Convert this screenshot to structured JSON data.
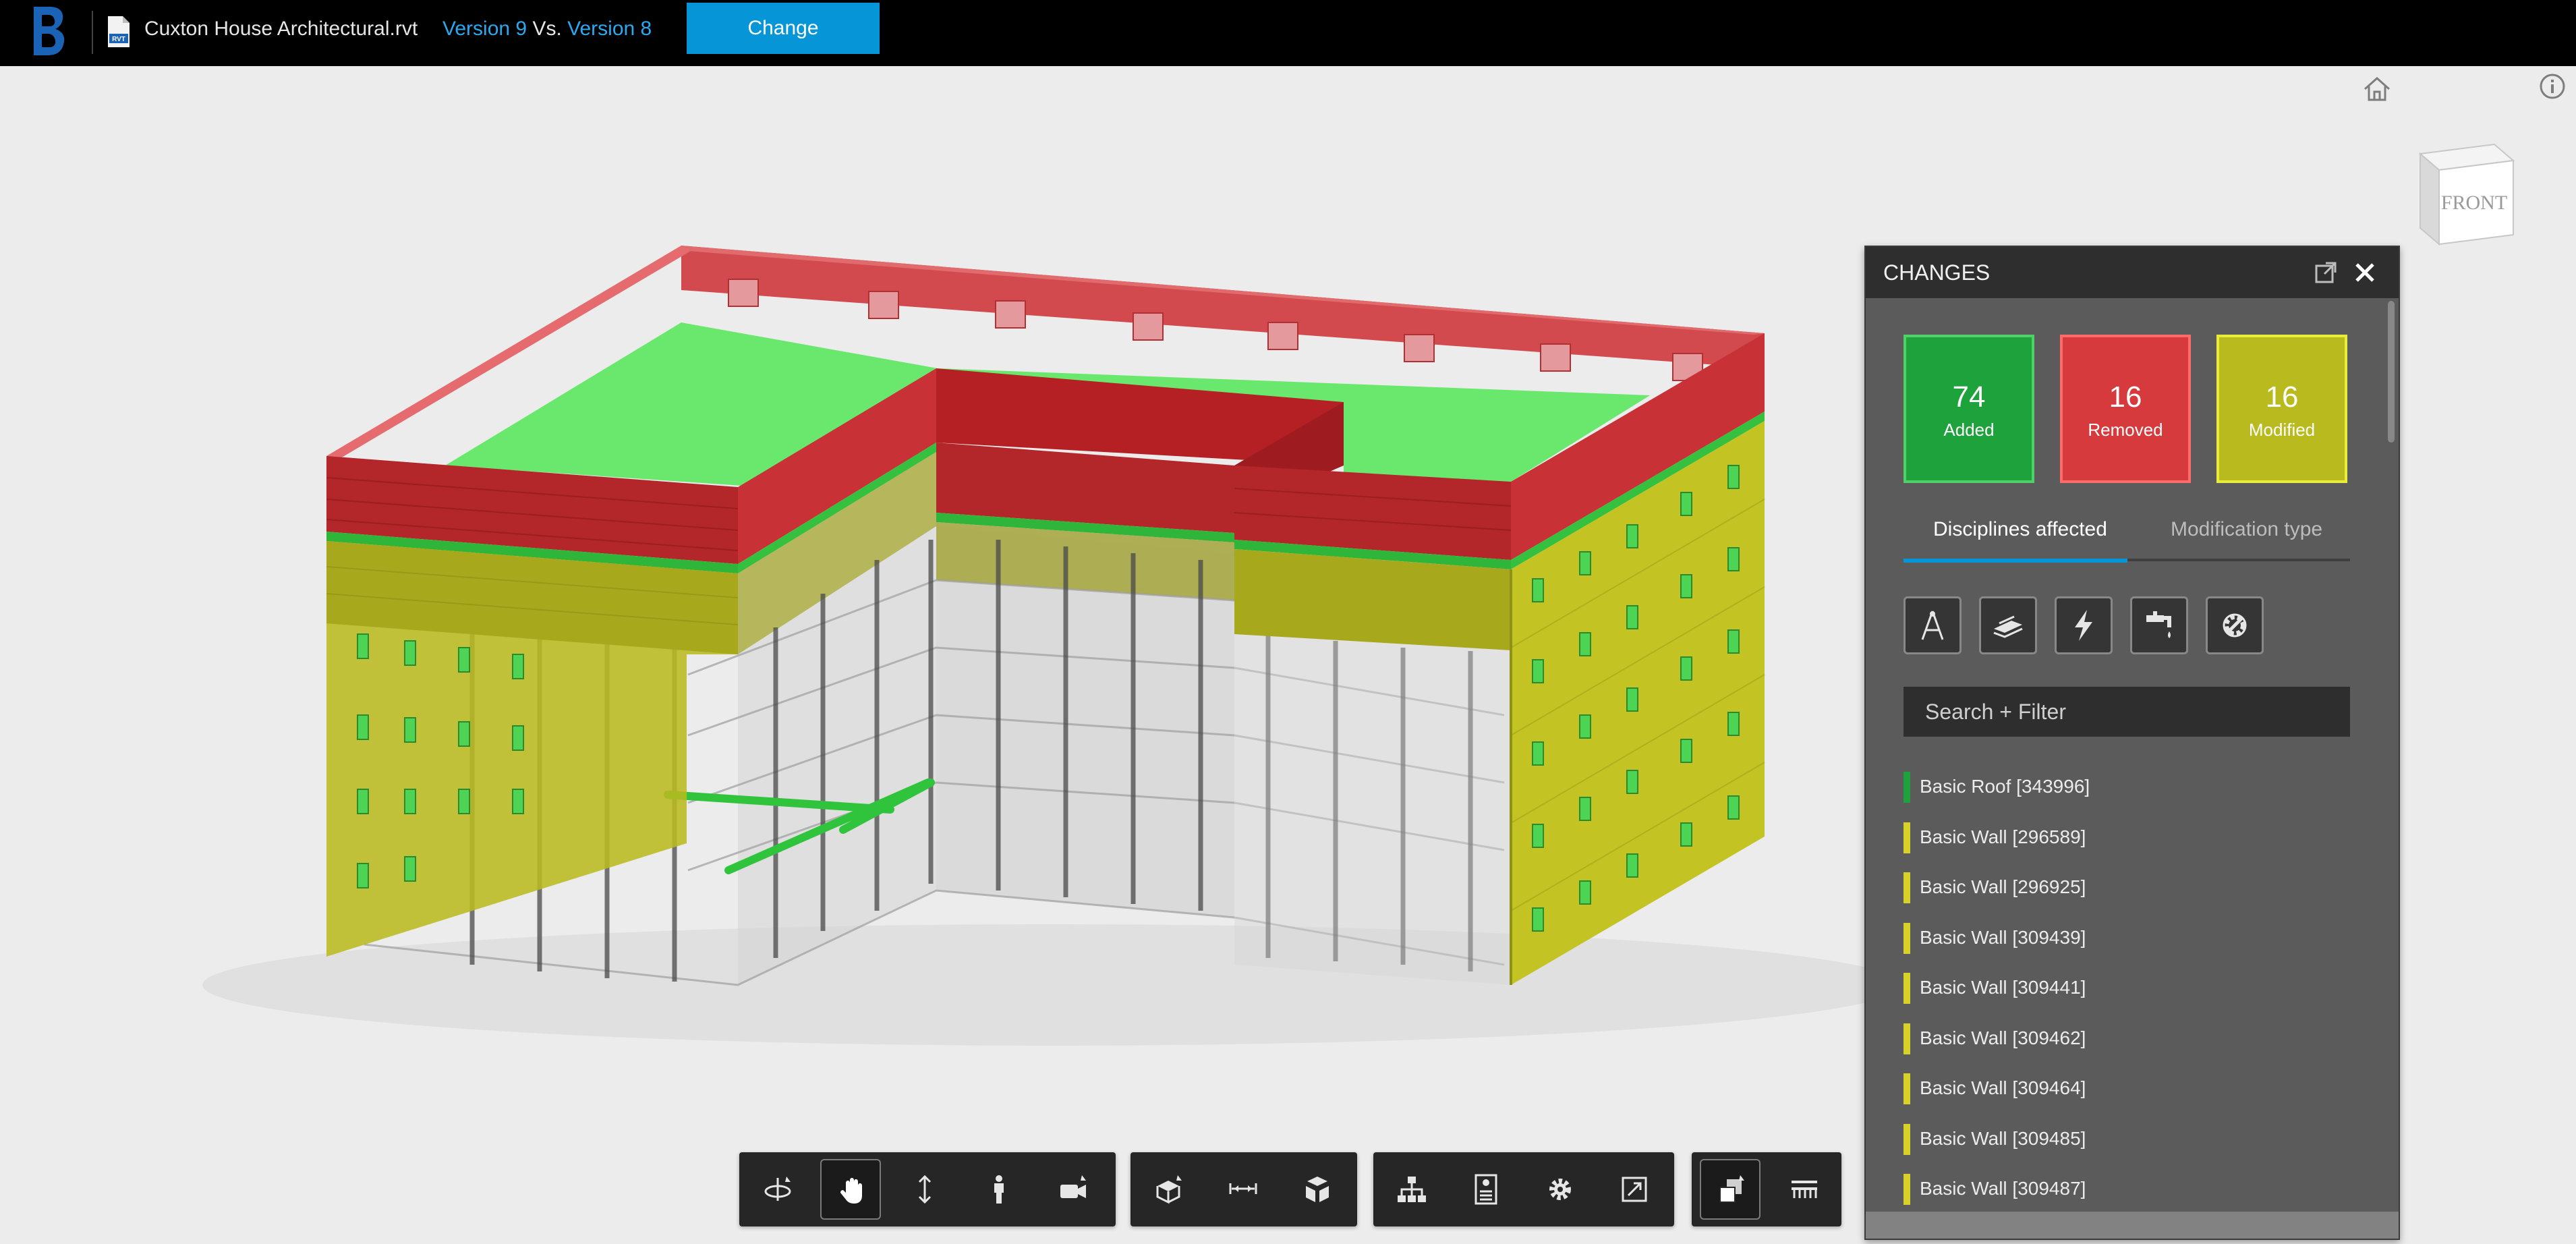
{
  "header": {
    "file_name": "Cuxton House Architectural.rvt",
    "version_current": "Version 9",
    "vs_label": "Vs.",
    "version_compare": "Version 8",
    "change_button": "Change"
  },
  "viewcube": {
    "face_label": "FRONT"
  },
  "changes_panel": {
    "title": "CHANGES",
    "stats": [
      {
        "count": "74",
        "label": "Added",
        "color": "#1ea23b"
      },
      {
        "count": "16",
        "label": "Removed",
        "color": "#d63a3c"
      },
      {
        "count": "16",
        "label": "Modified",
        "color": "#b8ba1e"
      }
    ],
    "tabs": [
      {
        "label": "Disciplines affected",
        "active": true
      },
      {
        "label": "Modification type",
        "active": false
      }
    ],
    "discipline_filters": [
      "architecture-icon",
      "structure-icon",
      "electrical-icon",
      "plumbing-icon",
      "mechanical-icon"
    ],
    "search_placeholder": "Search + Filter",
    "items": [
      {
        "label": "Basic Roof [343996]",
        "status": "added",
        "color": "#1ea23b"
      },
      {
        "label": "Basic Wall [296589]",
        "status": "modified",
        "color": "#d8d12a"
      },
      {
        "label": "Basic Wall [296925]",
        "status": "modified",
        "color": "#d8d12a"
      },
      {
        "label": "Basic Wall [309439]",
        "status": "modified",
        "color": "#d8d12a"
      },
      {
        "label": "Basic Wall [309441]",
        "status": "modified",
        "color": "#d8d12a"
      },
      {
        "label": "Basic Wall [309462]",
        "status": "modified",
        "color": "#d8d12a"
      },
      {
        "label": "Basic Wall [309464]",
        "status": "modified",
        "color": "#d8d12a"
      },
      {
        "label": "Basic Wall [309485]",
        "status": "modified",
        "color": "#d8d12a"
      },
      {
        "label": "Basic Wall [309487]",
        "status": "modified",
        "color": "#d8d12a"
      }
    ]
  },
  "toolbar": {
    "groups": [
      [
        "orbit-icon",
        "pan-icon",
        "zoom-icon",
        "first-person-icon",
        "camera-icon"
      ],
      [
        "section-box-icon",
        "measure-icon",
        "explode-icon"
      ],
      [
        "model-browser-icon",
        "properties-icon",
        "settings-icon",
        "fullscreen-icon"
      ],
      [
        "compare-icon",
        "levels-icon"
      ]
    ],
    "active": [
      "pan-icon",
      "compare-icon"
    ]
  }
}
